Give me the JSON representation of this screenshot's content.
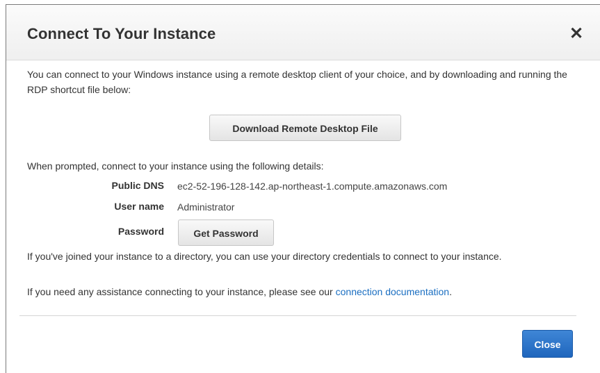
{
  "dialog": {
    "title": "Connect To Your Instance",
    "close_icon": "close-icon",
    "close_glyph": "✕",
    "intro_text": "You can connect to your Windows instance using a remote desktop client of your choice, and by downloading and running the RDP shortcut file below:",
    "download_button_label": "Download Remote Desktop File",
    "prompt_text": "When prompted, connect to your instance using the following details:",
    "details": {
      "public_dns_label": "Public DNS",
      "public_dns_value": "ec2-52-196-128-142.ap-northeast-1.compute.amazonaws.com",
      "user_name_label": "User name",
      "user_name_value": "Administrator",
      "password_label": "Password",
      "get_password_button_label": "Get Password"
    },
    "directory_text": "If you've joined your instance to a directory, you can use your directory credentials to connect to your instance.",
    "help_text_prefix": "If you need any assistance connecting to your instance, please see our ",
    "help_link_text": "connection documentation",
    "help_text_suffix": ".",
    "footer": {
      "close_button_label": "Close"
    }
  },
  "colors": {
    "link": "#1a6ec1",
    "primary_button": "#2a72c8",
    "text": "#333333"
  }
}
